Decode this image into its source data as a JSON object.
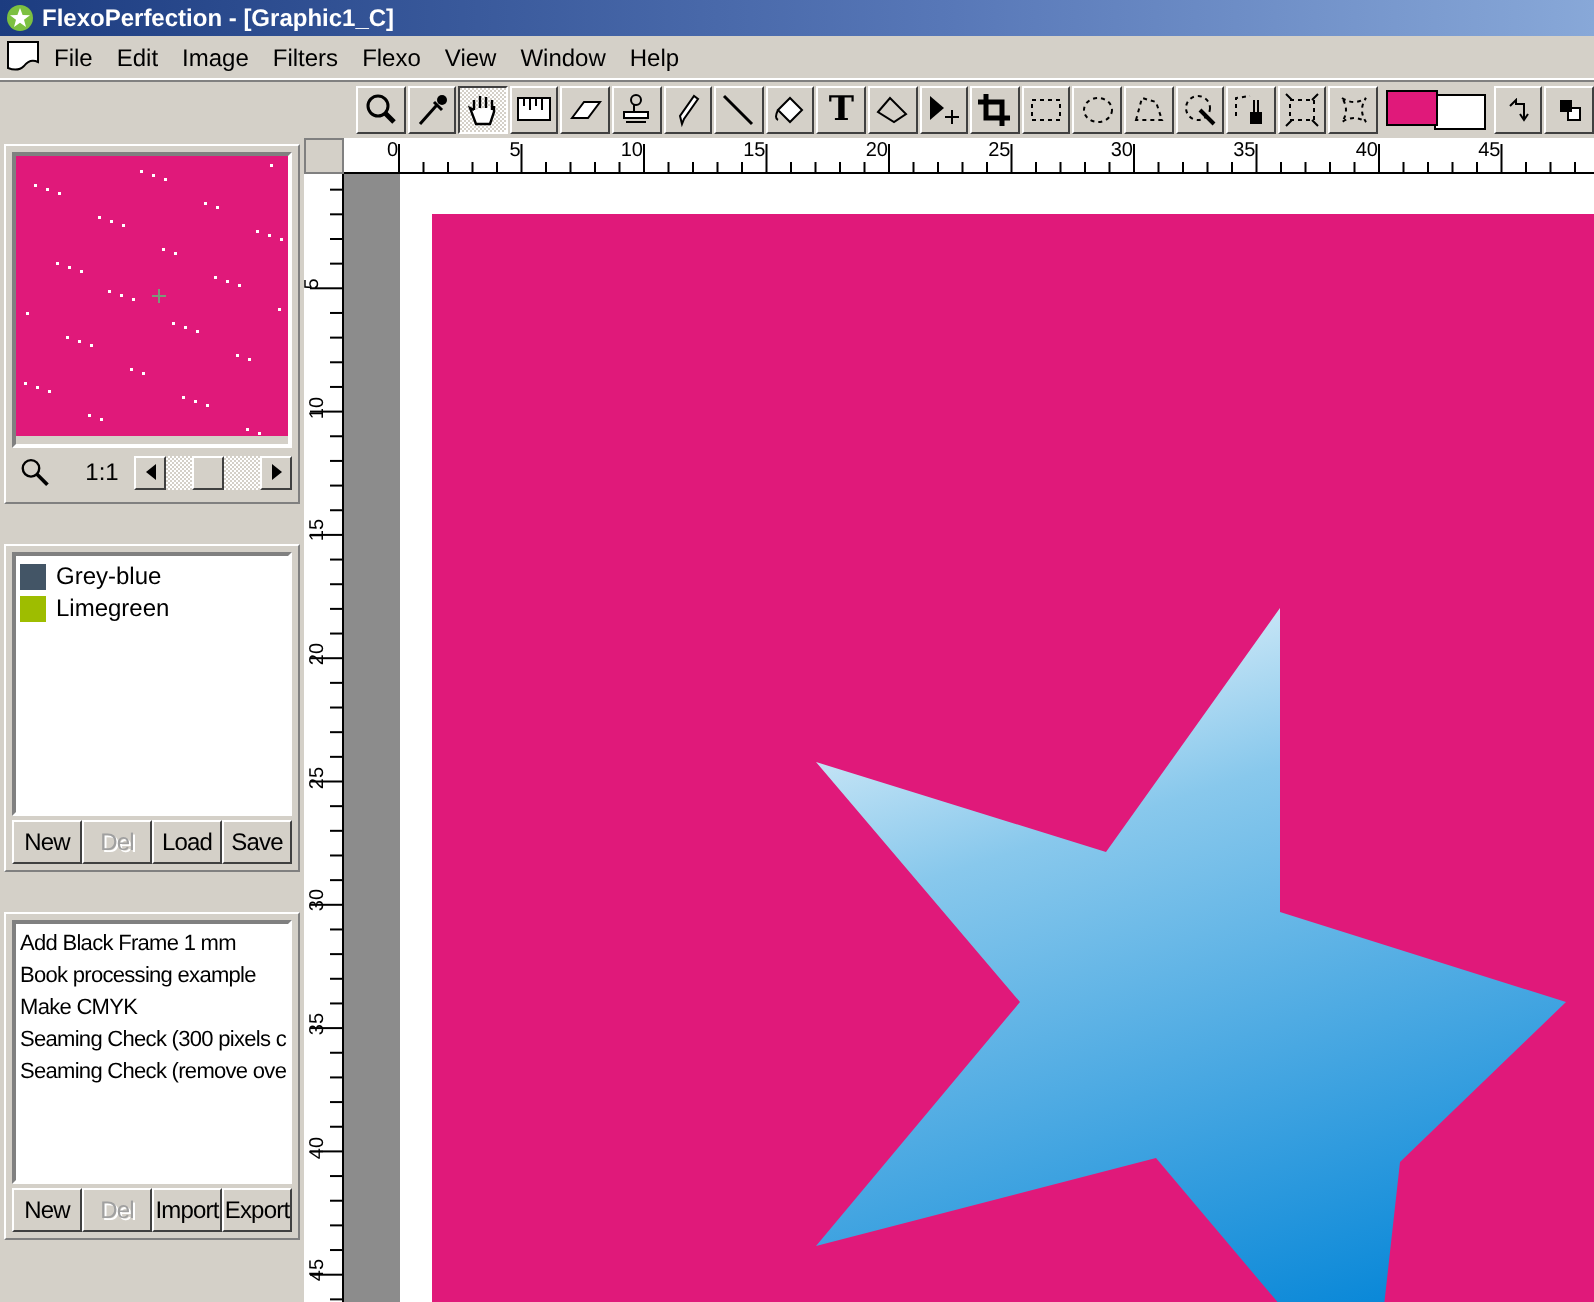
{
  "window": {
    "title": "FlexoPerfection - [Graphic1_C]"
  },
  "menu": [
    "File",
    "Edit",
    "Image",
    "Filters",
    "Flexo",
    "View",
    "Window",
    "Help"
  ],
  "toolbar": {
    "tools": [
      {
        "kind": "zoom",
        "selected": false
      },
      {
        "kind": "eyedropper",
        "selected": false
      },
      {
        "kind": "hand",
        "selected": true
      },
      {
        "kind": "ruler",
        "selected": false
      },
      {
        "kind": "eraser",
        "selected": false
      },
      {
        "kind": "stamp",
        "selected": false
      },
      {
        "kind": "pencil",
        "selected": false
      },
      {
        "kind": "line",
        "selected": false
      },
      {
        "kind": "fill",
        "selected": false
      },
      {
        "kind": "text",
        "glyph": "T",
        "selected": false
      },
      {
        "kind": "polygon",
        "selected": false
      },
      {
        "kind": "move",
        "selected": false
      },
      {
        "kind": "crop",
        "selected": false
      },
      {
        "kind": "rect-select",
        "selected": false
      },
      {
        "kind": "ellipse-select",
        "selected": false
      },
      {
        "kind": "lasso",
        "selected": false
      },
      {
        "kind": "wand",
        "selected": false
      },
      {
        "kind": "brush-select",
        "selected": false
      },
      {
        "kind": "shrink",
        "selected": false
      },
      {
        "kind": "expand",
        "selected": false
      }
    ],
    "swatches": [
      {
        "kind": "foreground",
        "color": "#e0197a"
      },
      {
        "kind": "background",
        "color": "#ffffff"
      }
    ]
  },
  "navigator": {
    "zoom": "1:1",
    "level": 0.4
  },
  "color_list": {
    "items": [
      {
        "name": "Grey-blue",
        "color": "#435566"
      },
      {
        "name": "Limegreen",
        "color": "#9ebd00"
      }
    ],
    "buttons": [
      {
        "label": "New",
        "disabled": false
      },
      {
        "label": "Del",
        "disabled": true
      },
      {
        "label": "Load",
        "disabled": false
      },
      {
        "label": "Save",
        "disabled": false
      }
    ]
  },
  "action_list": {
    "items": [
      "Add Black Frame 1 mm",
      "Book processing example",
      "Make CMYK",
      "Seaming Check (300 pixels c",
      "Seaming Check (remove ove"
    ],
    "buttons": [
      {
        "label": "New",
        "disabled": false
      },
      {
        "label": "Del",
        "disabled": true
      },
      {
        "label": "Import",
        "disabled": false
      },
      {
        "label": "Export",
        "disabled": false
      }
    ]
  },
  "rulers": {
    "horizontal": [
      "0",
      "5",
      "10",
      "15",
      "20",
      "25",
      "30",
      "35",
      "40",
      "45"
    ],
    "vertical": [
      "5",
      "10",
      "15",
      "20",
      "25",
      "30",
      "35",
      "40",
      "45"
    ]
  }
}
